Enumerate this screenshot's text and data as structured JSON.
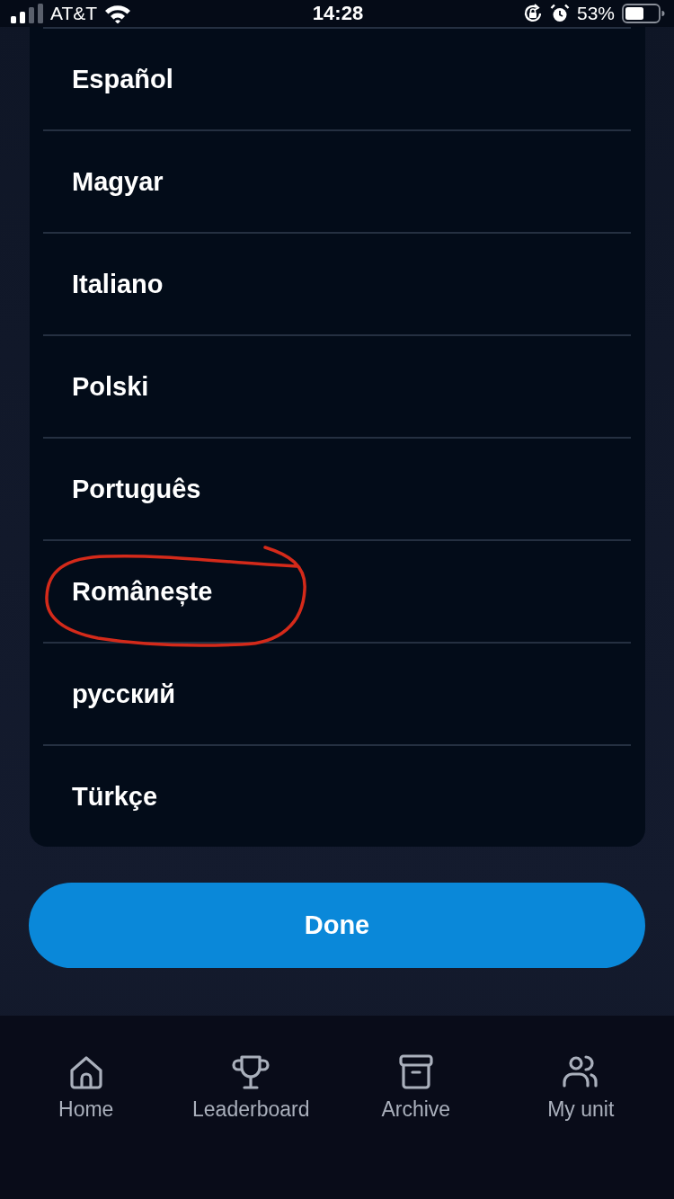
{
  "status_bar": {
    "carrier": "AT&T",
    "time": "14:28",
    "battery": "53%"
  },
  "languages": [
    {
      "label": "Español",
      "circled": false
    },
    {
      "label": "Magyar",
      "circled": false
    },
    {
      "label": "Italiano",
      "circled": false
    },
    {
      "label": "Polski",
      "circled": false
    },
    {
      "label": "Português",
      "circled": false
    },
    {
      "label": "Românește",
      "circled": true
    },
    {
      "label": "русский",
      "circled": false
    },
    {
      "label": "Türkçe",
      "circled": false
    }
  ],
  "done_button": {
    "label": "Done"
  },
  "tab_bar": [
    {
      "label": "Home"
    },
    {
      "label": "Leaderboard"
    },
    {
      "label": "Archive"
    },
    {
      "label": "My unit"
    }
  ]
}
